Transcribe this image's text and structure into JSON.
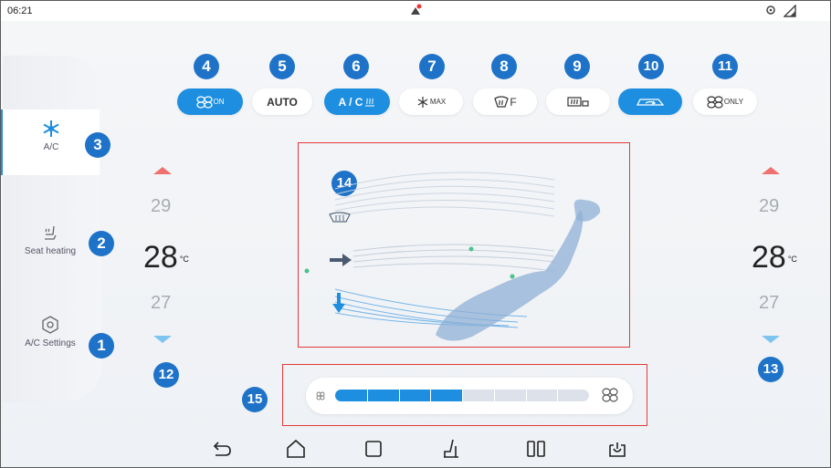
{
  "status_bar": {
    "time": "06:21"
  },
  "sidebar": {
    "items": [
      {
        "label": "A/C",
        "active": true
      },
      {
        "label": "Seat heating",
        "active": false
      },
      {
        "label": "A/C Settings",
        "active": false
      }
    ]
  },
  "callouts": {
    "n1": "1",
    "n2": "2",
    "n3": "3",
    "n4": "4",
    "n5": "5",
    "n6": "6",
    "n7": "7",
    "n8": "8",
    "n9": "9",
    "n10": "10",
    "n11": "11",
    "n12": "12",
    "n13": "13",
    "n14": "14",
    "n15": "15"
  },
  "controls": {
    "fan_on": {
      "text": "ON",
      "on": true
    },
    "auto": {
      "text": "AUTO",
      "on": false
    },
    "ac": {
      "text": "A / C",
      "on": true
    },
    "max": {
      "text": "MAX",
      "on": false
    },
    "front_defrost": {
      "text": "F",
      "on": false
    },
    "rear_defrost": {
      "on": false
    },
    "recirculation": {
      "on": true
    },
    "fan_only": {
      "text": "ONLY",
      "on": false
    }
  },
  "temperature": {
    "unit": "°C",
    "left": {
      "above": "29",
      "current": "28",
      "below": "27"
    },
    "right": {
      "above": "29",
      "current": "28",
      "below": "27"
    }
  },
  "fan_speed": {
    "level": 4,
    "max_level": 8
  },
  "colors": {
    "accent": "#1e8fe0",
    "badge": "#1e73c9",
    "highlight_box": "#e23a3a",
    "arrow_up": "#f07070",
    "arrow_down": "#7ec4ee"
  }
}
